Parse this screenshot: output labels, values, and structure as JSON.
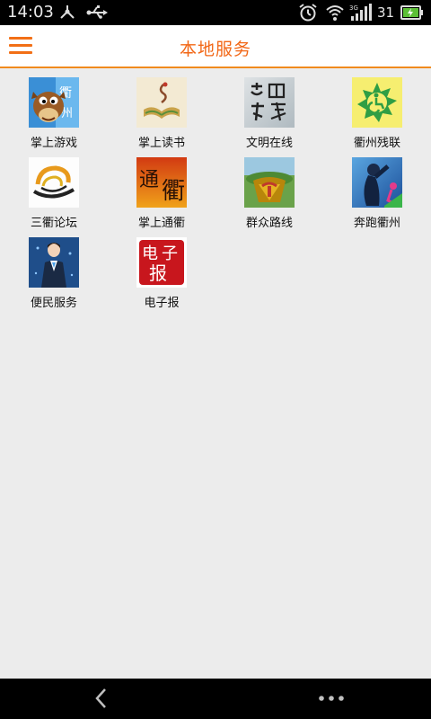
{
  "status_bar": {
    "time": "14:03",
    "battery": "31",
    "icons": [
      "share-icon",
      "usb-icon",
      "alarm-icon",
      "wifi-icon",
      "signal-3g-icon",
      "battery-icon"
    ]
  },
  "header": {
    "title": "本地服务",
    "menu_icon": "hamburger-menu-icon",
    "accent_color": "#f26716"
  },
  "services": [
    {
      "label": "掌上游戏",
      "icon": "game-mascot-icon"
    },
    {
      "label": "掌上读书",
      "icon": "open-book-icon"
    },
    {
      "label": "文明在线",
      "icon": "calligraphy-icon"
    },
    {
      "label": "衢州残联",
      "icon": "disability-federation-icon"
    },
    {
      "label": "三衢论坛",
      "icon": "forum-swirl-icon"
    },
    {
      "label": "掌上通衢",
      "icon": "tongqu-calligraphy-icon"
    },
    {
      "label": "群众路线",
      "icon": "party-emblem-icon"
    },
    {
      "label": "奔跑衢州",
      "icon": "runner-silhouette-icon"
    },
    {
      "label": "便民服务",
      "icon": "service-staff-icon"
    },
    {
      "label": "电子报",
      "icon": "e-newspaper-seal-icon"
    }
  ],
  "nav_bar": {
    "icons": [
      "back-arrow-icon",
      "more-dots-icon"
    ]
  }
}
